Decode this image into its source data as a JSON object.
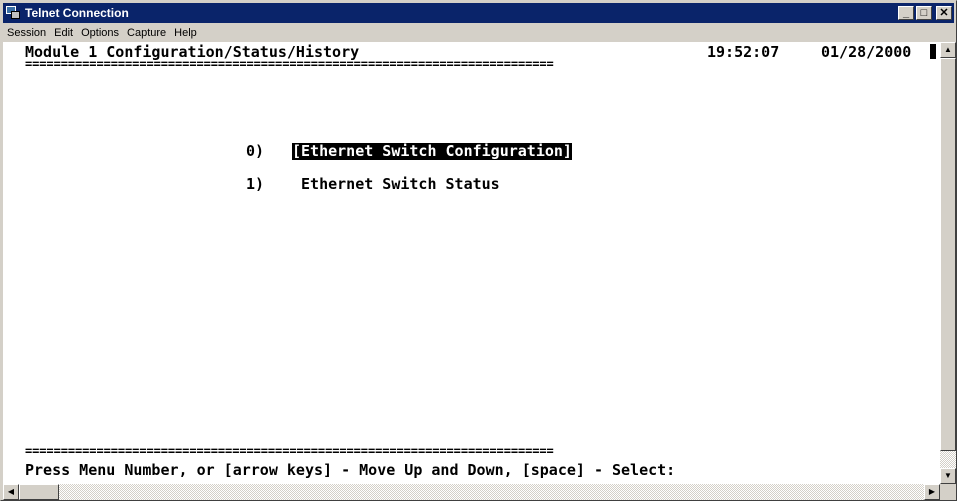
{
  "window": {
    "title": "Telnet Connection",
    "controls": {
      "minimize": "_",
      "maximize": "□",
      "close": "✕"
    }
  },
  "menubar": [
    "Session",
    "Edit",
    "Options",
    "Capture",
    "Help"
  ],
  "terminal": {
    "header_title": "Module 1 Configuration/Status/History",
    "time": "19:52:07",
    "date": "01/28/2000",
    "separator": "==========================================================================",
    "menu": [
      {
        "number": "0)",
        "label": "[Ethernet Switch Configuration]",
        "selected": true
      },
      {
        "number": "1)",
        "label": " Ethernet Switch Status",
        "selected": false
      }
    ],
    "prompt": "Press Menu Number, or [arrow keys] - Move Up and Down, [space] - Select:"
  },
  "icons": {
    "app": "telnet-icon",
    "scroll_up": "arrow-up-icon",
    "scroll_down": "arrow-down-icon",
    "scroll_left": "arrow-left-icon",
    "scroll_right": "arrow-right-icon"
  },
  "colors": {
    "titlebar": "#0a246a",
    "terminal_bg": "#ffffff",
    "terminal_fg": "#000000",
    "highlight_bg": "#000000"
  }
}
